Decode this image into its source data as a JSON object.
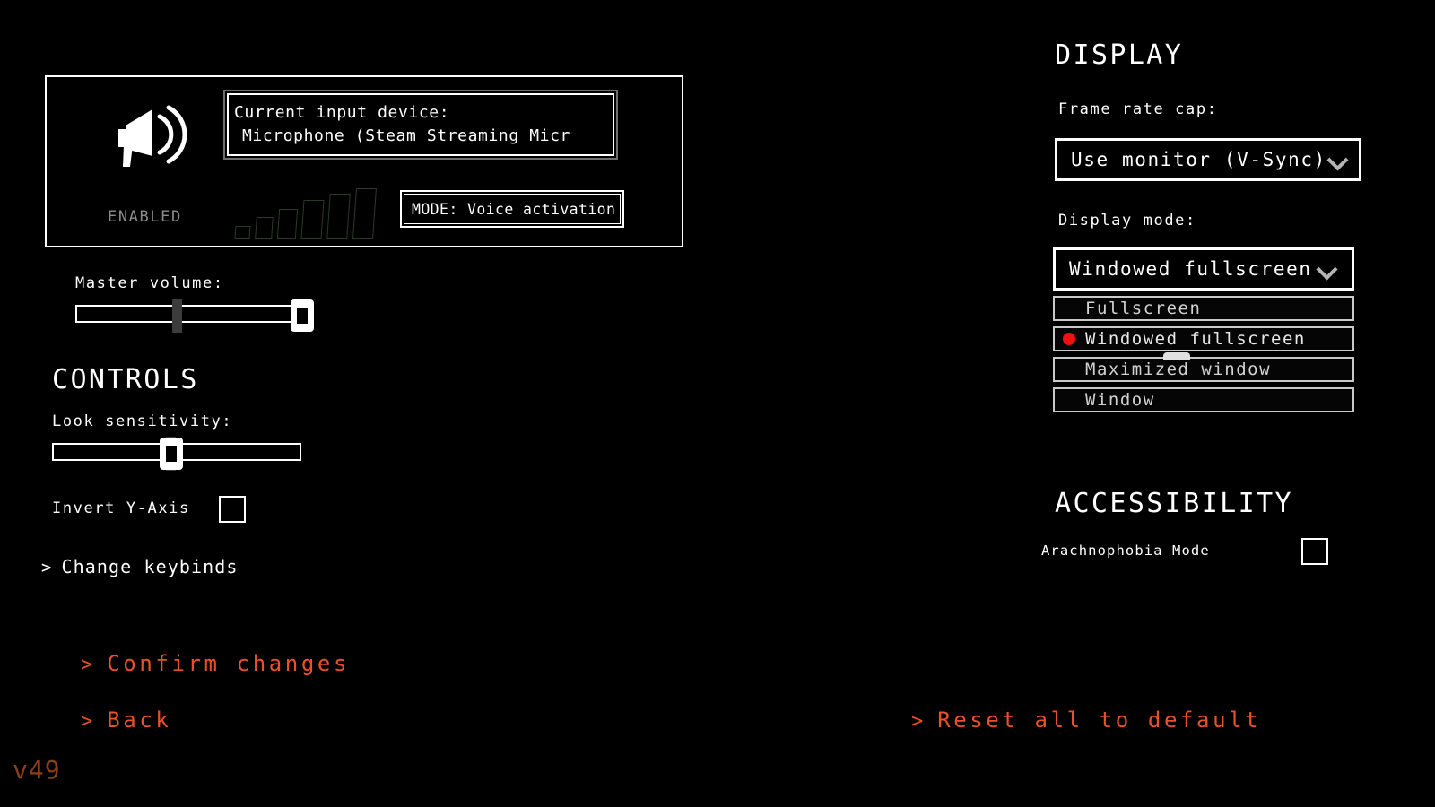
{
  "audio": {
    "icon": "megaphone-speaker-icon",
    "status": "ENABLED",
    "device_label": "Current input device:",
    "device_value": "Microphone (Steam Streaming Micr",
    "mode_label": "MODE: Voice activation",
    "vu_meter": {
      "bars": 6,
      "heights": [
        14,
        24,
        33,
        43,
        50,
        56
      ],
      "color": "#2a3a28"
    }
  },
  "audio_settings": {
    "master_volume_label": "Master volume:",
    "master_volume_value": 100,
    "master_volume_tick": 42
  },
  "controls": {
    "heading": "CONTROLS",
    "look_sensitivity_label": "Look sensitivity:",
    "look_sensitivity_value": 47,
    "look_sensitivity_tick": 47,
    "invert_y_label": "Invert Y-Axis",
    "invert_y_checked": false,
    "change_keybinds_label": "Change keybinds",
    "chevron": ">"
  },
  "display": {
    "heading": "DISPLAY",
    "frame_rate_label": "Frame rate cap:",
    "frame_rate_value": "Use monitor (V-Sync)",
    "display_mode_label": "Display mode:",
    "display_mode_value": "Windowed fullscreen",
    "display_mode_options": [
      {
        "label": "Fullscreen",
        "selected": false
      },
      {
        "label": "Windowed fullscreen",
        "selected": true
      },
      {
        "label": "Maximized window",
        "selected": false
      },
      {
        "label": "Window",
        "selected": false
      }
    ]
  },
  "accessibility": {
    "heading": "ACCESSIBILITY",
    "arachnophobia_label": "Arachnophobia Mode",
    "arachnophobia_checked": false
  },
  "actions": {
    "chevron": ">",
    "confirm_label": "Confirm changes",
    "back_label": "Back",
    "reset_label": "Reset all to default"
  },
  "footer": {
    "version": "v49"
  },
  "colors": {
    "accent_orange": "#e8512a",
    "version_orange": "#8a3f18",
    "selected_dot_red": "#ef1111",
    "vu_green": "#2a3a28",
    "muted_grey": "#8c8c8c"
  }
}
